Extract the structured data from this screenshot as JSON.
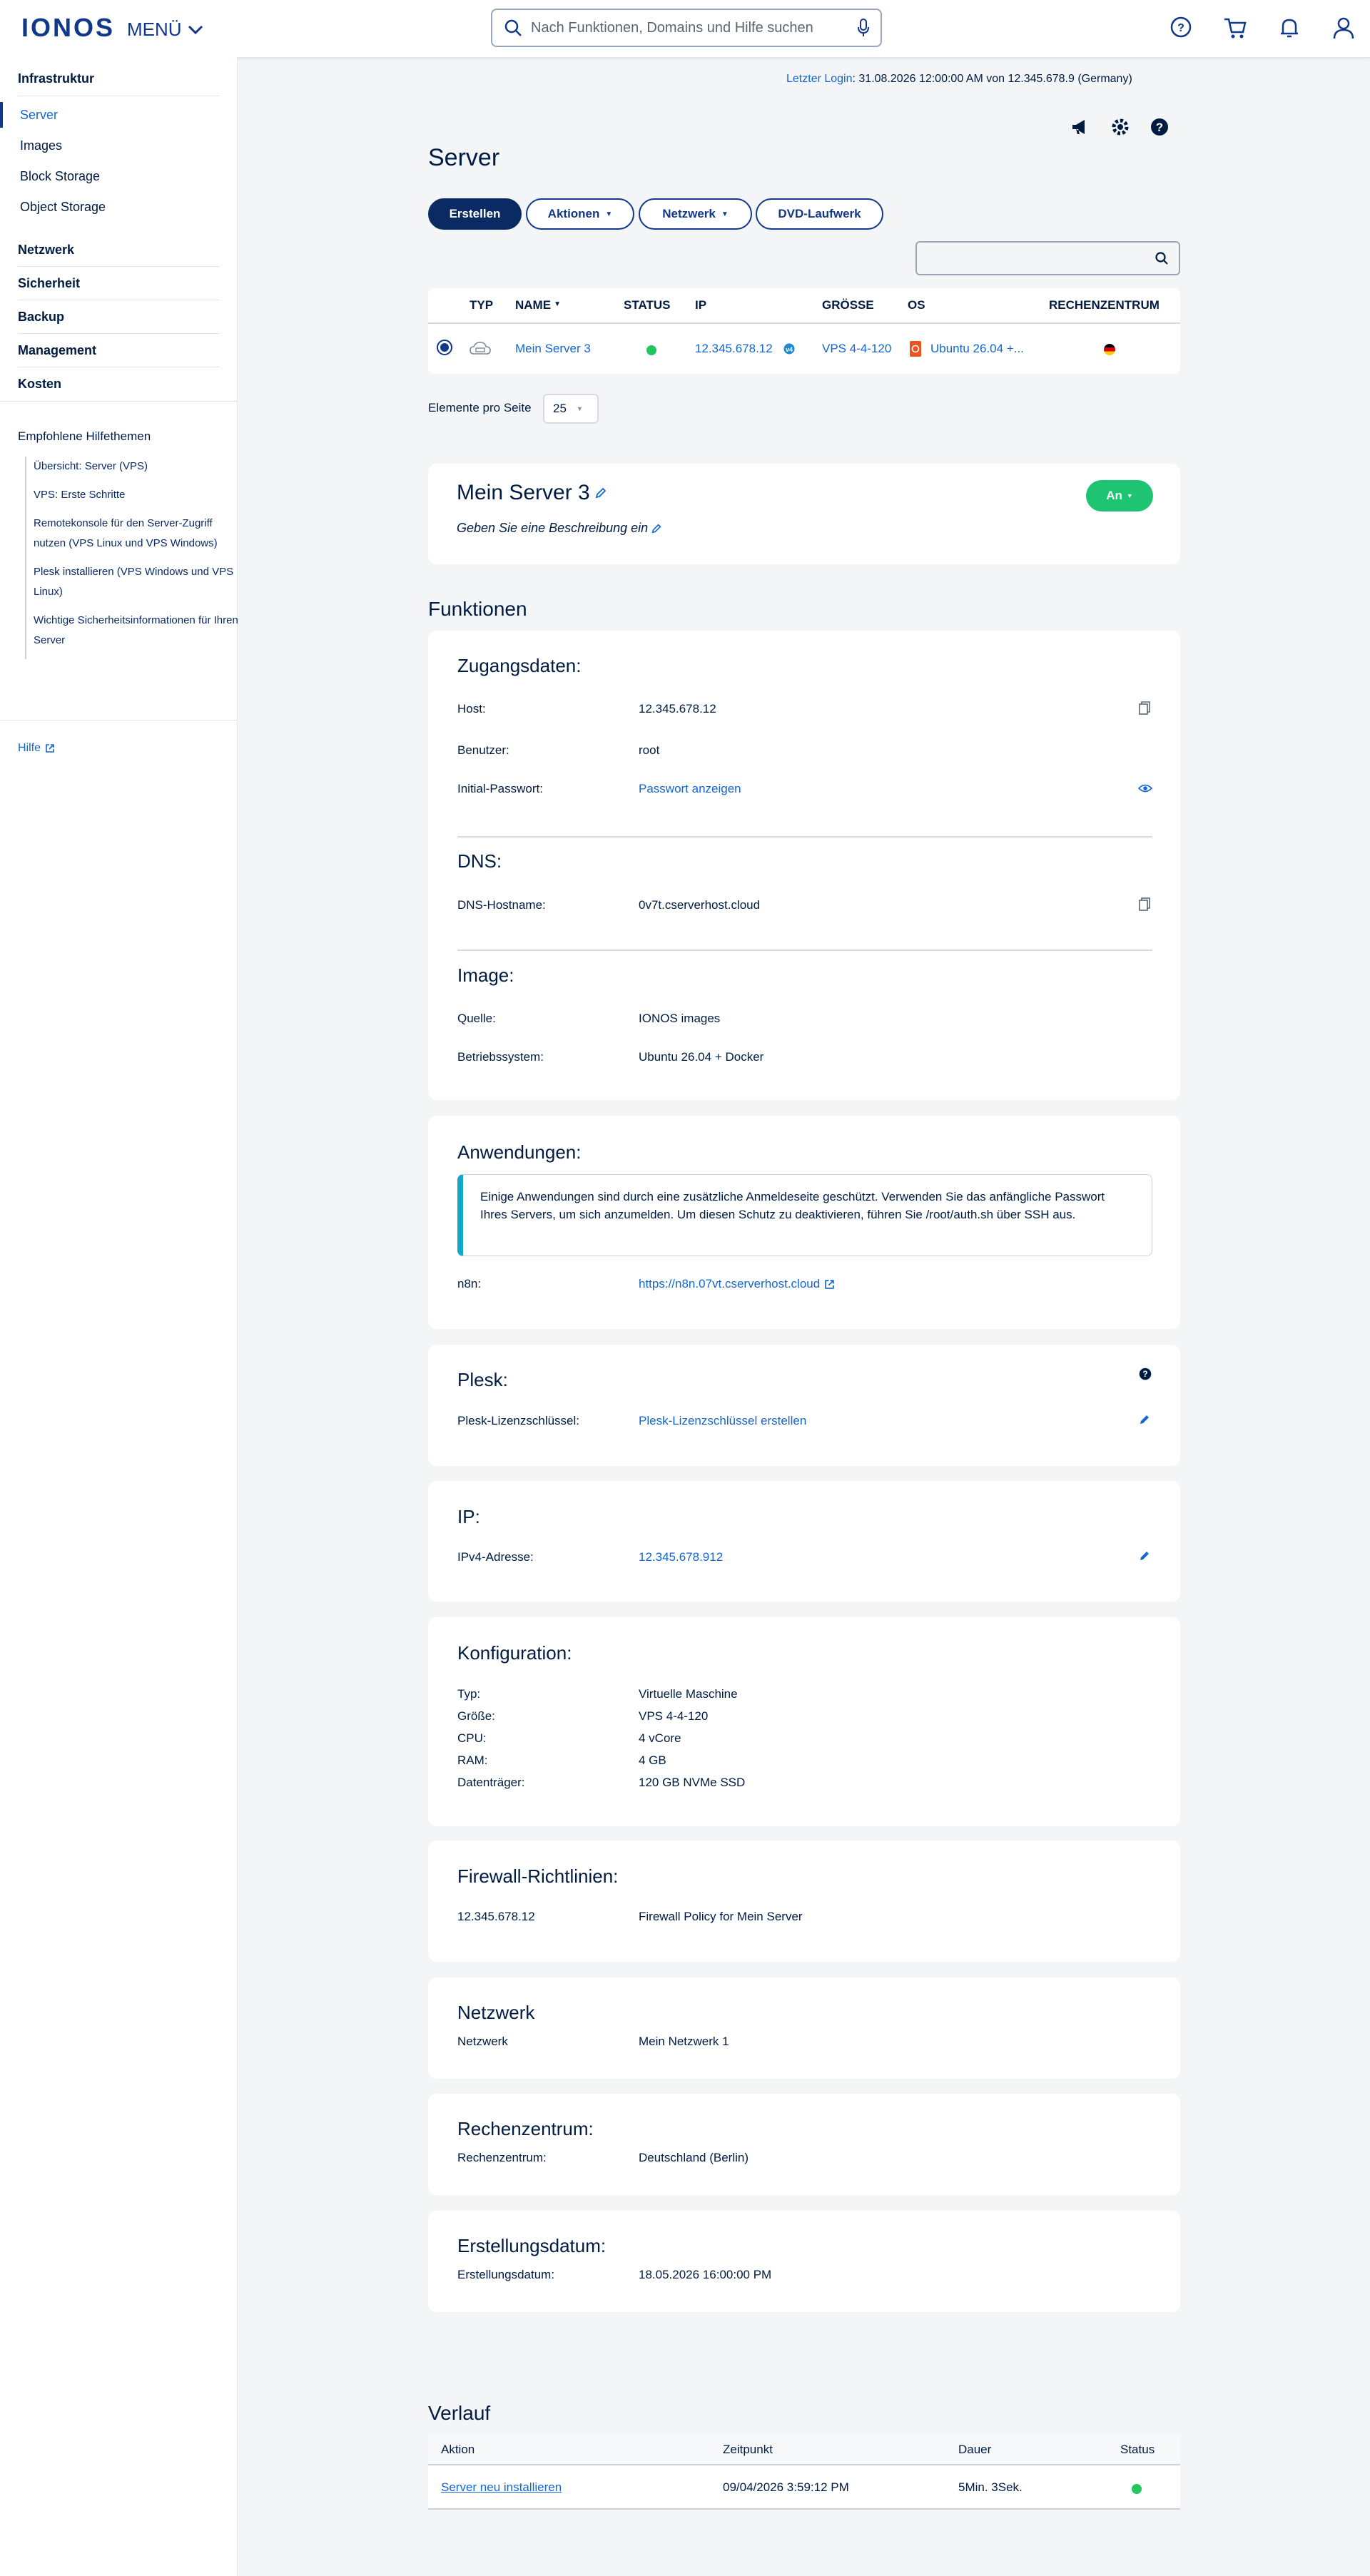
{
  "header": {
    "logo": "IONOS",
    "menu_label": "MENÜ",
    "search_placeholder": "Nach Funktionen, Domains und Hilfe suchen"
  },
  "sidebar": {
    "sections": [
      {
        "title": "Infrastruktur",
        "items": [
          "Server",
          "Images",
          "Block Storage",
          "Object Storage"
        ],
        "active": "Server"
      },
      {
        "title": "Netzwerk"
      },
      {
        "title": "Sicherheit"
      },
      {
        "title": "Backup"
      },
      {
        "title": "Management"
      },
      {
        "title": "Kosten"
      }
    ],
    "help_title": "Empfohlene Hilfethemen",
    "help_items": [
      "Übersicht: Server (VPS)",
      "VPS: Erste Schritte",
      "Remotekonsole für den Server-Zugriff nutzen (VPS Linux und VPS Windows)",
      "Plesk installieren (VPS Windows und VPS Linux)",
      "Wichtige Sicherheitsinformationen für Ihren Server"
    ],
    "help_link": "Hilfe"
  },
  "last_login": {
    "label": "Letzter Login",
    "value": ": 31.08.2026 12:00:00 AM von 12.345.678.9 (Germany)"
  },
  "page_title": "Server",
  "toolbar": {
    "create": "Erstellen",
    "actions": "Aktionen",
    "network": "Netzwerk",
    "dvd": "DVD-Laufwerk"
  },
  "server_table": {
    "headers": [
      "TYP",
      "NAME",
      "STATUS",
      "IP",
      "GRÖSSE",
      "OS",
      "RECHENZENTRUM"
    ],
    "row": {
      "name": "Mein Server 3",
      "ip": "12.345.678.12",
      "size": "VPS 4-4-120",
      "os": "Ubuntu 26.04 +..."
    }
  },
  "pagination": {
    "label": "Elemente pro Seite",
    "value": "25"
  },
  "server_card": {
    "name": "Mein Server 3",
    "description": "Geben Sie eine Beschreibung ein",
    "status_button": "An"
  },
  "functions_title": "Funktionen",
  "access": {
    "title": "Zugangsdaten:",
    "host_label": "Host:",
    "host_value": "12.345.678.12",
    "user_label": "Benutzer:",
    "user_value": "root",
    "pw_label": "Initial-Passwort:",
    "pw_value": "Passwort anzeigen"
  },
  "dns": {
    "title": "DNS:",
    "hostname_label": "DNS-Hostname:",
    "hostname_value": "0v7t.cserverhost.cloud"
  },
  "image": {
    "title": "Image:",
    "source_label": "Quelle:",
    "source_value": "IONOS images",
    "os_label": "Betriebssystem:",
    "os_value": "Ubuntu 26.04 + Docker"
  },
  "apps": {
    "title": "Anwendungen:",
    "notice": "Einige Anwendungen sind durch eine zusätzliche Anmeldeseite geschützt. Verwenden Sie das anfängliche Passwort Ihres Servers, um sich anzumelden. Um diesen Schutz zu deaktivieren, führen Sie /root/auth.sh über SSH aus.",
    "n8n_label": "n8n:",
    "n8n_value": "https://n8n.07vt.cserverhost.cloud"
  },
  "plesk": {
    "title": "Plesk:",
    "key_label": "Plesk-Lizenzschlüssel:",
    "key_value": "Plesk-Lizenzschlüssel erstellen"
  },
  "ip": {
    "title": "IP:",
    "ipv4_label": "IPv4-Adresse:",
    "ipv4_value": "12.345.678.912"
  },
  "config": {
    "title": "Konfiguration:",
    "rows": [
      {
        "label": "Typ:",
        "value": "Virtuelle Maschine"
      },
      {
        "label": "Größe:",
        "value": "VPS 4-4-120"
      },
      {
        "label": "CPU:",
        "value": "4 vCore"
      },
      {
        "label": "RAM:",
        "value": "4 GB"
      },
      {
        "label": "Datenträger:",
        "value": "120 GB NVMe SSD"
      }
    ]
  },
  "firewall": {
    "title": "Firewall-Richtlinien:",
    "ip": "12.345.678.12",
    "policy": "Firewall Policy for Mein Server"
  },
  "network": {
    "title": "Netzwerk",
    "label": "Netzwerk",
    "value": "Mein Netzwerk 1"
  },
  "datacenter": {
    "title": "Rechenzentrum:",
    "label": "Rechenzentrum:",
    "value": "Deutschland (Berlin)"
  },
  "created": {
    "title": "Erstellungsdatum:",
    "label": "Erstellungsdatum:",
    "value": "18.05.2026 16:00:00 PM"
  },
  "history": {
    "title": "Verlauf",
    "headers": [
      "Aktion",
      "Zeitpunkt",
      "Dauer",
      "Status"
    ],
    "row": {
      "action": "Server neu installieren",
      "time": "09/04/2026 3:59:12 PM",
      "duration": "5Min. 3Sek."
    }
  },
  "colors": {
    "brand": "#11388a",
    "link": "#1466d0",
    "status_ok": "#22c55e",
    "accent_notice": "#14a8c8"
  }
}
